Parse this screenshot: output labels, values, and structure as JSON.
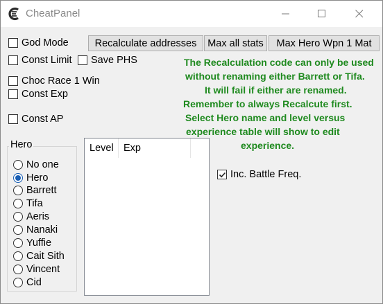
{
  "window": {
    "title": "CheatPanel",
    "controls": {
      "minimize": "minimize-icon",
      "maximize": "maximize-icon",
      "close": "close-icon"
    }
  },
  "checkboxes": {
    "god_mode": {
      "label": "God Mode",
      "checked": false
    },
    "const_limit": {
      "label": "Const Limit",
      "checked": false
    },
    "save_phs": {
      "label": "Save PHS",
      "checked": false
    },
    "choc_race": {
      "label": "Choc Race 1 Win",
      "checked": false
    },
    "const_exp": {
      "label": "Const Exp",
      "checked": false
    },
    "const_ap": {
      "label": "Const AP",
      "checked": false
    },
    "inc_battle_freq": {
      "label": "Inc. Battle Freq.",
      "checked": true
    }
  },
  "buttons": {
    "recalculate": "Recalculate addresses",
    "max_stats": "Max all stats",
    "max_weapon": "Max Hero Wpn 1 Mat"
  },
  "note": {
    "lines": [
      "The Recalculation code can only be used",
      "without renaming either Barrett or Tifa.",
      "It will fail if either are renamed.",
      "Remember to always Recalcute first.",
      "Select Hero name and level versus",
      "experience table will show to edit",
      "experience."
    ],
    "color": "#1f8a1f"
  },
  "hero_group": {
    "legend": "Hero",
    "selected": "Hero",
    "options": [
      "No one",
      "Hero",
      "Barrett",
      "Tifa",
      "Aeris",
      "Nanaki",
      "Yuffie",
      "Cait Sith",
      "Vincent",
      "Cid"
    ]
  },
  "table": {
    "columns": [
      "Level",
      "Exp"
    ],
    "rows": []
  },
  "accent_color": "#1a5fb4"
}
